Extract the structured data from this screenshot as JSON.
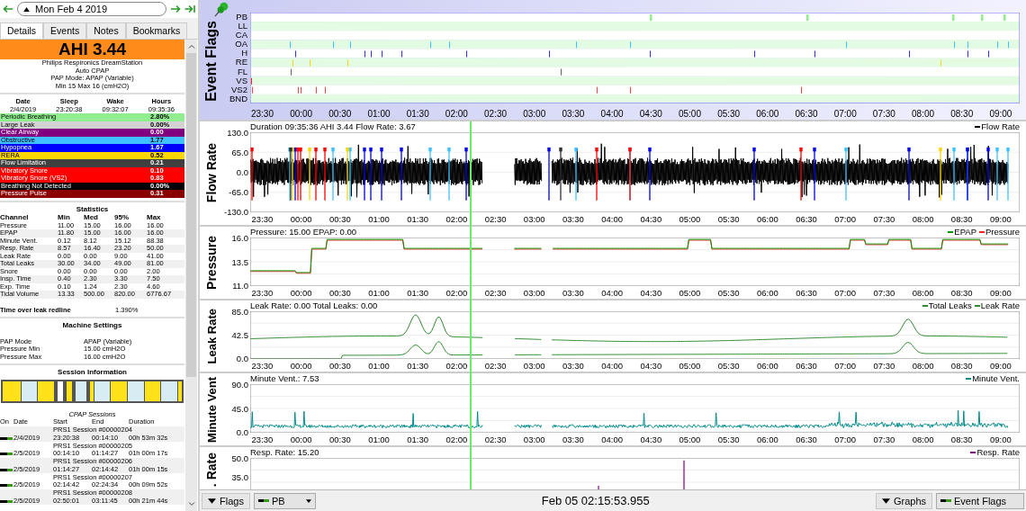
{
  "date_nav": {
    "date": "Mon Feb 4 2019"
  },
  "tabs": [
    {
      "label": "Details",
      "selected": true
    },
    {
      "label": "Events",
      "selected": false
    },
    {
      "label": "Notes",
      "selected": false
    },
    {
      "label": "Bookmarks",
      "selected": false
    }
  ],
  "summary": {
    "ahi": "AHI 3.44",
    "lines": [
      "Philips Respironics DreamStation",
      "Auto CPAP",
      "PAP Mode: APAP (Variable)",
      "Min 15 Max 16 (cmH2O)"
    ]
  },
  "times": {
    "headers": [
      "Date",
      "Sleep",
      "Wake",
      "Hours"
    ],
    "values": [
      "2/4/2019",
      "23:20:38",
      "09:32:07",
      "09:35:36"
    ]
  },
  "indices": [
    {
      "name": "Periodic Breathing",
      "value": "2.80%",
      "color": "#90ee90"
    },
    {
      "name": "Large Leak",
      "value": "0.00%",
      "color": "#d3d3d3"
    },
    {
      "name": "Clear Airway",
      "value": "0.00",
      "color": "#800080"
    },
    {
      "name": "Obstructive",
      "value": "1.77",
      "color": "#40c0ff"
    },
    {
      "name": "Hypopnea",
      "value": "1.67",
      "color": "#0000ff"
    },
    {
      "name": "RERA",
      "value": "0.52",
      "color": "#ffd700"
    },
    {
      "name": "Flow Limitation",
      "value": "0.21",
      "color": "#404040"
    },
    {
      "name": "Vibratory Snore",
      "value": "0.10",
      "color": "#ff0000"
    },
    {
      "name": "Vibratory Snore (VS2)",
      "value": "0.83",
      "color": "#ff0000"
    },
    {
      "name": "Breathing Not Detected",
      "value": "0.00%",
      "color": "#000000"
    },
    {
      "name": "Pressure Pulse",
      "value": "0.31",
      "color": "#8b0000"
    }
  ],
  "statistics": {
    "title": "Statistics",
    "columns": [
      "Channel",
      "Min",
      "Med",
      "95%",
      "Max"
    ],
    "rows": [
      [
        "Pressure",
        "11.00",
        "15.00",
        "16.00",
        "16.00"
      ],
      [
        "EPAP",
        "11.80",
        "15.00",
        "16.00",
        "16.00"
      ],
      [
        "Minute Vent.",
        "0.12",
        "8.12",
        "15.12",
        "88.38"
      ],
      [
        "Resp. Rate",
        "8.57",
        "16.40",
        "23.20",
        "50.00"
      ],
      [
        "Leak Rate",
        "0.00",
        "0.00",
        "9.00",
        "41.00"
      ],
      [
        "Total Leaks",
        "30.00",
        "34.00",
        "49.00",
        "81.00"
      ],
      [
        "Snore",
        "0.00",
        "0.00",
        "0.00",
        "2.00"
      ],
      [
        "Insp. Time",
        "0.40",
        "2.30",
        "3.30",
        "7.50"
      ],
      [
        "Exp. Time",
        "0.10",
        "1.24",
        "2.30",
        "4.60"
      ],
      [
        "Tidal Volume",
        "13.33",
        "500.00",
        "820.00",
        "6776.67"
      ]
    ]
  },
  "leak_redline": {
    "label": "Time over leak redline",
    "value": "1.390%"
  },
  "machine_settings": {
    "title": "Machine Settings",
    "rows": [
      [
        "PAP Mode",
        "APAP (Variable)"
      ],
      [
        "Pressure Min",
        "15.00 cmH2O"
      ],
      [
        "Pressure Max",
        "16.00 cmH2O"
      ]
    ]
  },
  "session_info": {
    "title": "Session Information"
  },
  "cpap_sessions": {
    "title": "CPAP Sessions",
    "columns": [
      "On",
      "Date",
      "Start",
      "End",
      "Duration"
    ],
    "rows": [
      {
        "name": "PRS1 Session #00000204",
        "on": true,
        "date": "2/4/2019",
        "start": "23:20:38",
        "end": "00:14:10",
        "duration": "00h 53m 32s"
      },
      {
        "name": "PRS1 Session #00000205",
        "on": true,
        "date": "2/5/2019",
        "start": "00:14:10",
        "end": "01:14:27",
        "duration": "01h 00m 17s"
      },
      {
        "name": "PRS1 Session #00000206",
        "on": true,
        "date": "2/5/2019",
        "start": "01:14:27",
        "end": "02:14:42",
        "duration": "01h 00m 15s"
      },
      {
        "name": "PRS1 Session #00000207",
        "on": true,
        "date": "2/5/2019",
        "start": "02:14:42",
        "end": "02:24:34",
        "duration": "00h 09m 52s"
      },
      {
        "name": "PRS1 Session #00000208",
        "on": true,
        "date": "2/5/2019",
        "start": "02:50:01",
        "end": "03:11:45",
        "duration": "00h 21m 44s"
      }
    ]
  },
  "graphs": [
    {
      "kind": "flags",
      "title": "Event Flags",
      "rows": [
        "PB",
        "LL",
        "CA",
        "OA",
        "H",
        "RE",
        "FL",
        "VS",
        "VS2",
        "BND"
      ],
      "time_labels": [
        "23:30",
        "00:00",
        "00:30",
        "01:00",
        "01:30",
        "02:00",
        "02:30",
        "03:00",
        "03:30",
        "04:00",
        "04:30",
        "05:00",
        "05:30",
        "06:00",
        "06:30",
        "07:00",
        "07:30",
        "08:00",
        "08:30",
        "09:00"
      ]
    },
    {
      "kind": "flow",
      "title": "Flow Rate",
      "info": "Duration 09:35:36 AHI 3.44 Flow Rate: 3.67",
      "legend": [
        {
          "name": "Flow Rate",
          "color": "#000000"
        }
      ],
      "yticks": [
        "130.0",
        "65.0",
        "0.0",
        "-65.0",
        "-130.0"
      ],
      "time_labels": [
        "23:30",
        "00:00",
        "00:30",
        "01:00",
        "01:30",
        "02:00",
        "02:30",
        "03:00",
        "03:30",
        "04:00",
        "04:30",
        "05:00",
        "05:30",
        "06:00",
        "06:30",
        "07:00",
        "07:30",
        "08:00",
        "08:30",
        "09:00"
      ]
    },
    {
      "kind": "pressure",
      "title": "Pressure",
      "info": "Pressure: 15.00 EPAP: 0.00",
      "legend": [
        {
          "name": "EPAP",
          "color": "#009900"
        },
        {
          "name": "Pressure",
          "color": "#ff2020"
        }
      ],
      "yticks": [
        "16.0",
        "13.5",
        "11.0"
      ],
      "time_labels": [
        "23:30",
        "00:00",
        "00:30",
        "01:00",
        "01:30",
        "02:00",
        "02:30",
        "03:00",
        "03:30",
        "04:00",
        "04:30",
        "05:00",
        "05:30",
        "06:00",
        "06:30",
        "07:00",
        "07:30",
        "08:00",
        "08:30",
        "09:00"
      ]
    },
    {
      "kind": "leak",
      "title": "Leak Rate",
      "info": "Leak Rate: 0.00 Total Leaks: 0.00",
      "legend": [
        {
          "name": "Total Leaks",
          "color": "#2e8b2e"
        },
        {
          "name": "Leak Rate",
          "color": "#2e8b2e"
        }
      ],
      "yticks": [
        "85.0",
        "42.5",
        "0.0"
      ],
      "time_labels": [
        "23:30",
        "00:00",
        "00:30",
        "01:00",
        "01:30",
        "02:00",
        "02:30",
        "03:00",
        "03:30",
        "04:00",
        "04:30",
        "05:00",
        "05:30",
        "06:00",
        "06:30",
        "07:00",
        "07:30",
        "08:00",
        "08:30",
        "09:00"
      ]
    },
    {
      "kind": "minute_vent",
      "title": "Minute Vent",
      "info": "Minute Vent.: 7.53",
      "legend": [
        {
          "name": "Minute Vent.",
          "color": "#008b8b"
        }
      ],
      "yticks": [
        "90.0",
        "45.0",
        "0.0"
      ],
      "time_labels": [
        "23:30",
        "00:00",
        "00:30",
        "01:00",
        "01:30",
        "02:00",
        "02:30",
        "03:00",
        "03:30",
        "04:00",
        "04:30",
        "05:00",
        "05:30",
        "06:00",
        "06:30",
        "07:00",
        "07:30",
        "08:00",
        "08:30",
        "09:00"
      ]
    },
    {
      "kind": "resp",
      "title": ". Rate",
      "info": "Resp. Rate: 15.20",
      "legend": [
        {
          "name": "Resp. Rate",
          "color": "#800080"
        }
      ],
      "yticks": [
        "50.0",
        "35.0"
      ]
    }
  ],
  "bottom_bar": {
    "flags_button": "Flags",
    "flag_select": "PB",
    "timestamp": "Feb 05 02:15:53.955",
    "graphs_button": "Graphs",
    "graph_select": "Event Flags"
  }
}
